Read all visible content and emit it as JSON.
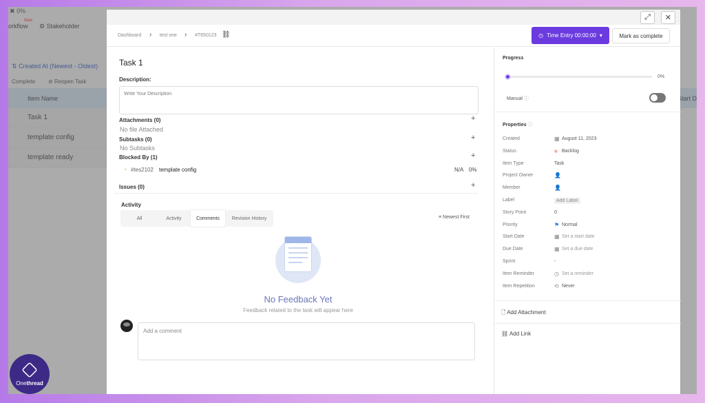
{
  "background": {
    "top_left_text": "0%",
    "nav_workflow": "orkflow",
    "nav_new_badge": "New",
    "nav_stakeholder": "Stakeholder",
    "sort_label": "Created At (Newest - Oldest)",
    "action_complete": "Complete",
    "action_reopen": "Reopen Task",
    "column_item_name": "Item Name",
    "column_start_date": "Start Da",
    "rows": [
      "Task 1",
      "template config",
      "template ready"
    ]
  },
  "modal": {
    "breadcrumb": [
      "Dashboard",
      "test one",
      "#T650123"
    ],
    "time_entry": "Time Entry 00:00:00",
    "mark_complete": "Mark as complete",
    "task_title": "Task 1",
    "description_label": "Description:",
    "description_placeholder": "Write Your Description",
    "attachments_label": "Attachments (0)",
    "attachments_empty": "No file Attached",
    "subtasks_label": "Subtasks (0)",
    "subtasks_empty": "No Subtasks",
    "blocked_label": "Blocked By (1)",
    "blocked_item": {
      "id": "#tes2102",
      "name": "template config",
      "na": "N/A",
      "percent": "0%"
    },
    "issues_label": "Issues (0)",
    "activity_label": "Activity",
    "tabs": [
      "All",
      "Activity",
      "Comments",
      "Revision History"
    ],
    "active_tab": "Comments",
    "sort_label": "Newest First",
    "empty_title": "No Feedback Yet",
    "empty_sub": "Feedback related to the task will appear here",
    "comment_placeholder": "Add a comment"
  },
  "right": {
    "progress_label": "Progress",
    "progress_value": "0%",
    "progress_fraction": 0,
    "manual_label": "Manual",
    "properties_label": "Properties",
    "props": [
      {
        "label": "Created",
        "value": "August 11, 2023",
        "icon": "calendar-icon"
      },
      {
        "label": "Status",
        "value": "Backlog",
        "icon": "status-icon"
      },
      {
        "label": "Item Type",
        "value": "Task",
        "icon": ""
      },
      {
        "label": "Project Owner",
        "value": "",
        "icon": "user-add-icon"
      },
      {
        "label": "Member",
        "value": "",
        "icon": "user-add-icon"
      },
      {
        "label": "Label",
        "value": "Add Label",
        "icon": ""
      },
      {
        "label": "Story Point",
        "value": "0",
        "icon": ""
      },
      {
        "label": "Priority",
        "value": "Normal",
        "icon": "flag-icon"
      },
      {
        "label": "Start Date",
        "value": "Set a start date",
        "icon": "calendar-icon"
      },
      {
        "label": "Due Date",
        "value": "Set a due date",
        "icon": "calendar-icon"
      },
      {
        "label": "Sprint",
        "value": "-",
        "icon": ""
      },
      {
        "label": "Item Reminder",
        "value": "Set a reminder",
        "icon": "clock-icon"
      },
      {
        "label": "Item Repetition",
        "value": "Never",
        "icon": "repeat-icon"
      }
    ],
    "add_attachment": "Add Attachment",
    "add_link": "Add Link"
  },
  "logo": {
    "text_light": "One",
    "text_bold": "thread"
  },
  "colors": {
    "accent": "#6b3be0",
    "priority_flag": "#2b7de9",
    "status": "#f4a9a0"
  }
}
